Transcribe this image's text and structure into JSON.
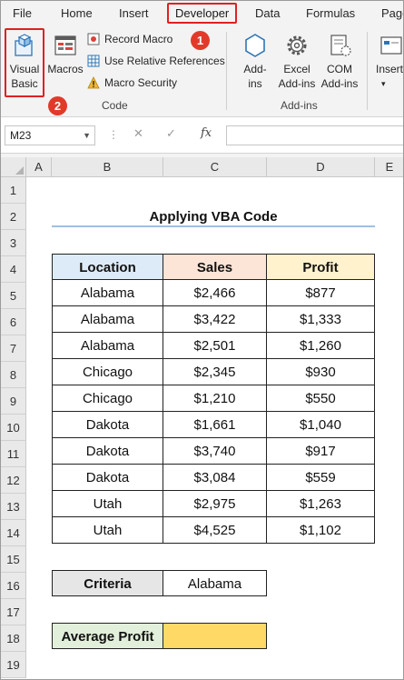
{
  "ribbon": {
    "tabs": [
      "File",
      "Home",
      "Insert",
      "Developer",
      "Data",
      "Formulas",
      "Page"
    ],
    "active_tab": "Developer",
    "code_group": {
      "visual_basic": "Visual Basic",
      "macros": "Macros",
      "record_macro": "Record Macro",
      "relative_refs": "Use Relative References",
      "macro_security": "Macro Security",
      "label": "Code"
    },
    "addins_group": {
      "addins": "Add-ins",
      "excel_addins": "Excel Add-ins",
      "com_addins": "COM Add-ins",
      "label": "Add-ins"
    },
    "insert": "Insert"
  },
  "badges": {
    "step1": "1",
    "step2": "2"
  },
  "formula_bar": {
    "name_box": "M23",
    "fx": "fx",
    "formula": ""
  },
  "columns": [
    "A",
    "B",
    "C",
    "D",
    "E"
  ],
  "rows": [
    "1",
    "2",
    "3",
    "4",
    "5",
    "6",
    "7",
    "8",
    "9",
    "10",
    "11",
    "12",
    "13",
    "14",
    "15",
    "16",
    "17",
    "18",
    "19"
  ],
  "sheet": {
    "title": "Applying VBA Code",
    "headers": [
      "Location",
      "Sales",
      "Profit"
    ],
    "data": [
      [
        "Alabama",
        "$2,466",
        "$877"
      ],
      [
        "Alabama",
        "$3,422",
        "$1,333"
      ],
      [
        "Alabama",
        "$2,501",
        "$1,260"
      ],
      [
        "Chicago",
        "$2,345",
        "$930"
      ],
      [
        "Chicago",
        "$1,210",
        "$550"
      ],
      [
        "Dakota",
        "$1,661",
        "$1,040"
      ],
      [
        "Dakota",
        "$3,740",
        "$917"
      ],
      [
        "Dakota",
        "$3,084",
        "$559"
      ],
      [
        "Utah",
        "$2,975",
        "$1,263"
      ],
      [
        "Utah",
        "$4,525",
        "$1,102"
      ]
    ],
    "criteria_label": "Criteria",
    "criteria_value": "Alabama",
    "avg_label": "Average Profit",
    "avg_value": ""
  },
  "colors": {
    "location_header": "#dcebf7",
    "sales_header": "#fce4d6",
    "profit_header": "#fff2cc",
    "label_fill": "#e7e6e6",
    "avg_label_fill": "#e2efda",
    "avg_value_fill": "#ffd966",
    "highlight": "#e02020"
  }
}
